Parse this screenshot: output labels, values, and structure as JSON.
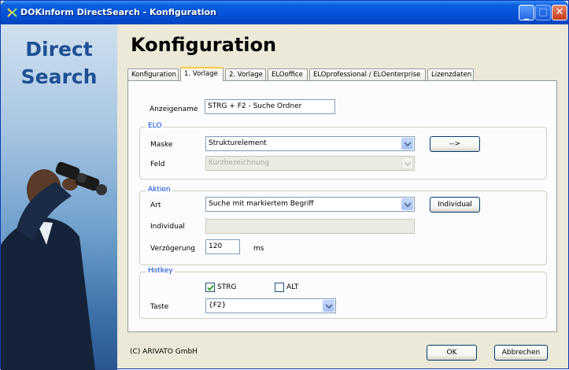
{
  "window": {
    "title": "DOKinform DirectSearch - Konfiguration"
  },
  "brand": {
    "line1": "Direct",
    "line2": "Search"
  },
  "page": {
    "heading": "Konfiguration"
  },
  "tabs": [
    {
      "label": "Konfiguration"
    },
    {
      "label": "1. Vorlage"
    },
    {
      "label": "2. Vorlage"
    },
    {
      "label": "ELOoffice"
    },
    {
      "label": "ELOprofessional / ELOenterprise"
    },
    {
      "label": "Lizenzdaten"
    }
  ],
  "form": {
    "anzeigename_label": "Anzeigename",
    "anzeigename_value": "STRG + F2 - Suche Ordner",
    "elo": {
      "title": "ELO",
      "maske_label": "Maske",
      "maske_value": "Strukturelement",
      "arrow_button": "-->",
      "feld_label": "Feld",
      "feld_value": "Kurzbezeichnung"
    },
    "aktion": {
      "title": "Aktion",
      "art_label": "Art",
      "art_value": "Suche mit markiertem Begriff",
      "individual_button": "Individual",
      "individual_label": "Individual",
      "individual_value": "",
      "verzoegerung_label": "Verzögerung",
      "verzoegerung_value": "120",
      "unit": "ms"
    },
    "hotkey": {
      "title": "Hotkey",
      "strg_label": "STRG",
      "strg_checked": true,
      "alt_label": "ALT",
      "alt_checked": false,
      "taste_label": "Taste",
      "taste_value": "{F2}"
    }
  },
  "footer": {
    "copyright": "(C) ARIVATO GmbH",
    "ok_button": "OK",
    "cancel_button": "Abbrechen"
  },
  "colors": {
    "titlebar": "#0550d8",
    "group_title": "#0046d5",
    "brand": "#1f4f93"
  }
}
